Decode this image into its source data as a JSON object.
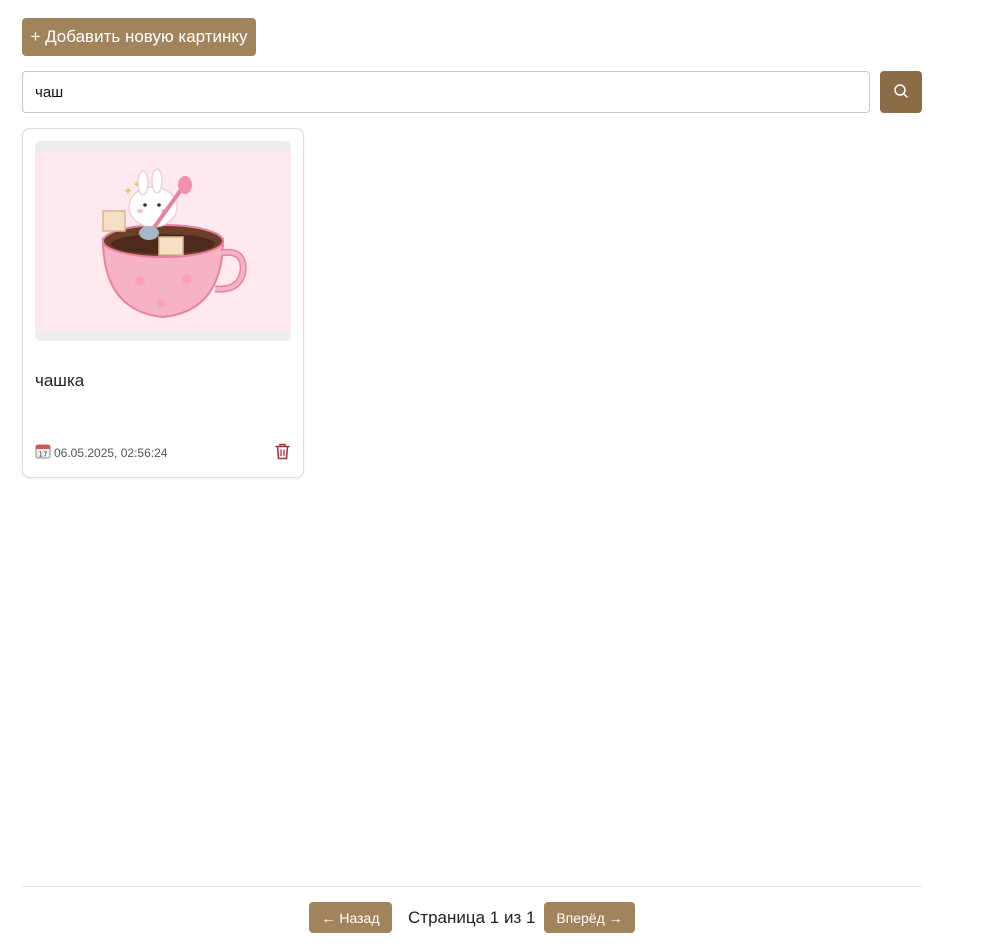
{
  "toolbar": {
    "add_label": "+ Добавить новую картинку"
  },
  "search": {
    "value": "чаш",
    "button_icon": "search-icon"
  },
  "accent_colors": {
    "primary": "#a1845c",
    "dark": "#8a6d47",
    "danger": "#b0323a"
  },
  "cards": [
    {
      "title": "чашка",
      "date": "06.05.2025, 02:56:24",
      "image": "pink cup with bunny and spoon",
      "date_icon": "calendar-icon",
      "delete_icon": "trash-icon"
    }
  ],
  "pagination": {
    "prev_label": "← Назад",
    "info": "Страница 1 из 1",
    "next_label": "Вперёд →"
  }
}
